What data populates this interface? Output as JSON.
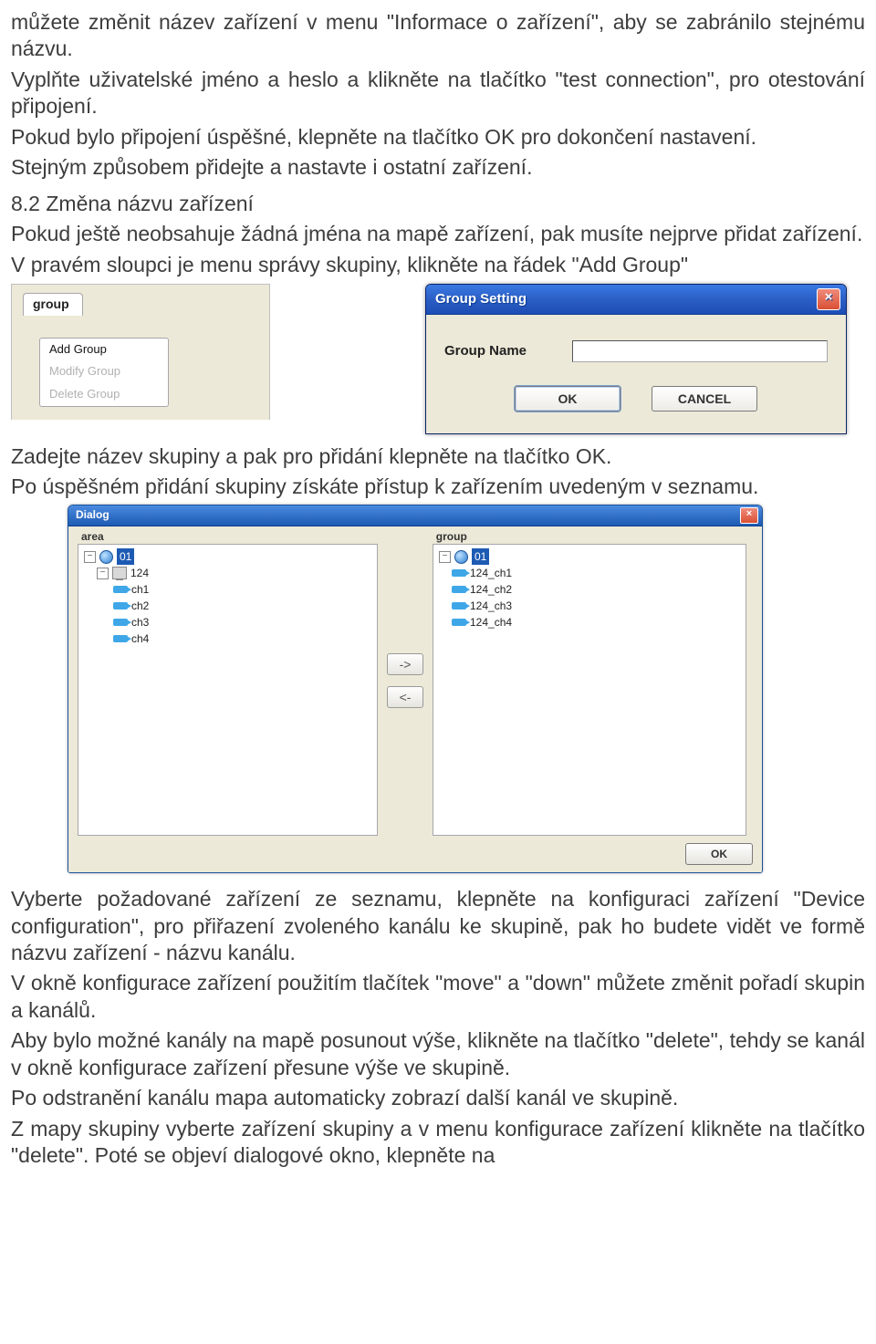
{
  "para1": "můžete změnit název zařízení v menu \"Informace o zařízení\", aby se zabránilo stejnému názvu.",
  "para2": "Vyplňte uživatelské jméno a heslo a klikněte na tlačítko \"test connection\", pro otestování připojení.",
  "para3": "Pokud bylo připojení úspěšné, klepněte na tlačítko OK pro dokončení nastavení.",
  "para4": "Stejným způsobem přidejte a nastavte i ostatní zařízení.",
  "sec82_title": "8.2 Změna názvu zařízení",
  "sec82_p1": "Pokud ještě neobsahuje žádná jména na mapě zařízení, pak musíte nejprve přidat zařízení.",
  "sec82_p2": "V pravém sloupci je menu správy skupiny, klikněte na řádek \"Add Group\"",
  "sec82_p3": "Zadejte název skupiny a pak pro přidání klepněte na tlačítko OK.",
  "sec82_p4": "Po úspěšném přidání skupiny získáte přístup k zařízením uvedeným v seznamu.",
  "sec82_p5": "Vyberte požadované zařízení ze seznamu, klepněte na konfiguraci zařízení \"Device configuration\", pro přiřazení zvoleného kanálu ke skupině, pak ho budete vidět ve formě názvu zařízení - názvu kanálu.",
  "sec82_p6": "V okně konfigurace zařízení použitím tlačítek \"move\" a \"down\" můžete změnit pořadí skupin a kanálů.",
  "sec82_p7": "Aby bylo možné kanály na mapě posunout výše, klikněte na tlačítko \"delete\", tehdy se kanál v okně konfigurace zařízení přesune výše ve skupině.",
  "sec82_p8": "Po odstranění kanálu mapa automaticky zobrazí další kanál ve skupině.",
  "sec82_p9": "Z mapy skupiny vyberte zařízení skupiny a v menu konfigurace zařízení klikněte na tlačítko \"delete\". Poté se objeví dialogové okno, klepněte na",
  "fig1": {
    "tab_label": "group",
    "menu": {
      "add": "Add Group",
      "modify": "Modify Group",
      "delete": "Delete Group"
    },
    "dialog_title": "Group Setting",
    "groupname_label": "Group Name",
    "groupname_value": "",
    "ok": "OK",
    "cancel": "CANCEL"
  },
  "fig2": {
    "title": "Dialog",
    "label_area": "area",
    "label_group": "group",
    "area_tree": {
      "root": "01",
      "device": "124",
      "channels": [
        "ch1",
        "ch2",
        "ch3",
        "ch4"
      ]
    },
    "group_tree": {
      "root": "01",
      "channels": [
        "124_ch1",
        "124_ch2",
        "124_ch3",
        "124_ch4"
      ]
    },
    "move_right": "->",
    "move_left": "<-",
    "ok": "OK"
  }
}
